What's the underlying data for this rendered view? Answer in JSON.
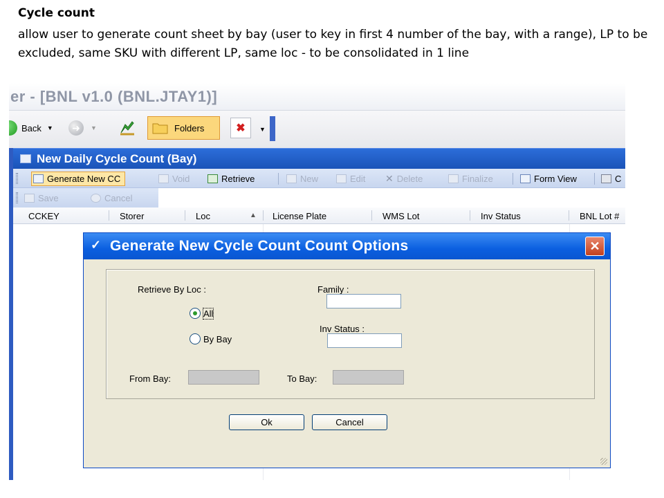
{
  "slide": {
    "title": "Cycle count",
    "description": "allow user to generate count sheet by bay (user to key in first 4 number of the bay, with a range), LP to be excluded, same SKU with different LP, same loc -  to be consolidated in 1 line"
  },
  "window": {
    "title": "er - [BNL v1.0 (BNL.JTAY1)]"
  },
  "nav": {
    "back_label": "Back",
    "folders_label": "Folders"
  },
  "panel": {
    "title": "New Daily Cycle Count (Bay)"
  },
  "toolbar": {
    "items": [
      {
        "label": "Generate New CC",
        "icon": "grid-icon"
      },
      {
        "label": "Void",
        "icon": "grid-icon"
      },
      {
        "label": "Retrieve",
        "icon": "refresh-icon"
      },
      {
        "label": "New",
        "icon": "new-document-icon"
      },
      {
        "label": "Edit",
        "icon": "edit-icon"
      },
      {
        "label": "Delete",
        "icon": "delete-x-icon"
      },
      {
        "label": "Finalize",
        "icon": "check-icon"
      },
      {
        "label": "Form View",
        "icon": "form-view-icon"
      },
      {
        "label": "C",
        "icon": "printer-icon"
      }
    ],
    "row2": [
      {
        "label": "Save",
        "icon": "save-icon"
      },
      {
        "label": "Cancel",
        "icon": "cancel-icon"
      }
    ]
  },
  "grid": {
    "columns": [
      "CCKEY",
      "Storer",
      "Loc",
      "License Plate",
      "WMS Lot",
      "Inv Status",
      "BNL Lot #"
    ]
  },
  "dialog": {
    "title": "Generate New Cycle Count Count Options",
    "close_symbol": "✕",
    "retrieve_by_loc_label": "Retrieve  By Loc :",
    "radio_all_label": "All",
    "radio_by_bay_label": "By Bay",
    "family_label": "Family :",
    "inv_status_label": "Inv Status :",
    "from_bay_label": "From Bay:",
    "to_bay_label": "To Bay:",
    "ok_label": "Ok",
    "cancel_label": "Cancel"
  },
  "colors": {
    "panel_header": "#1a53b8",
    "dialog_title": "#0b5fe0",
    "close_button": "#c2401d",
    "active_tool": "#fde7a6"
  }
}
